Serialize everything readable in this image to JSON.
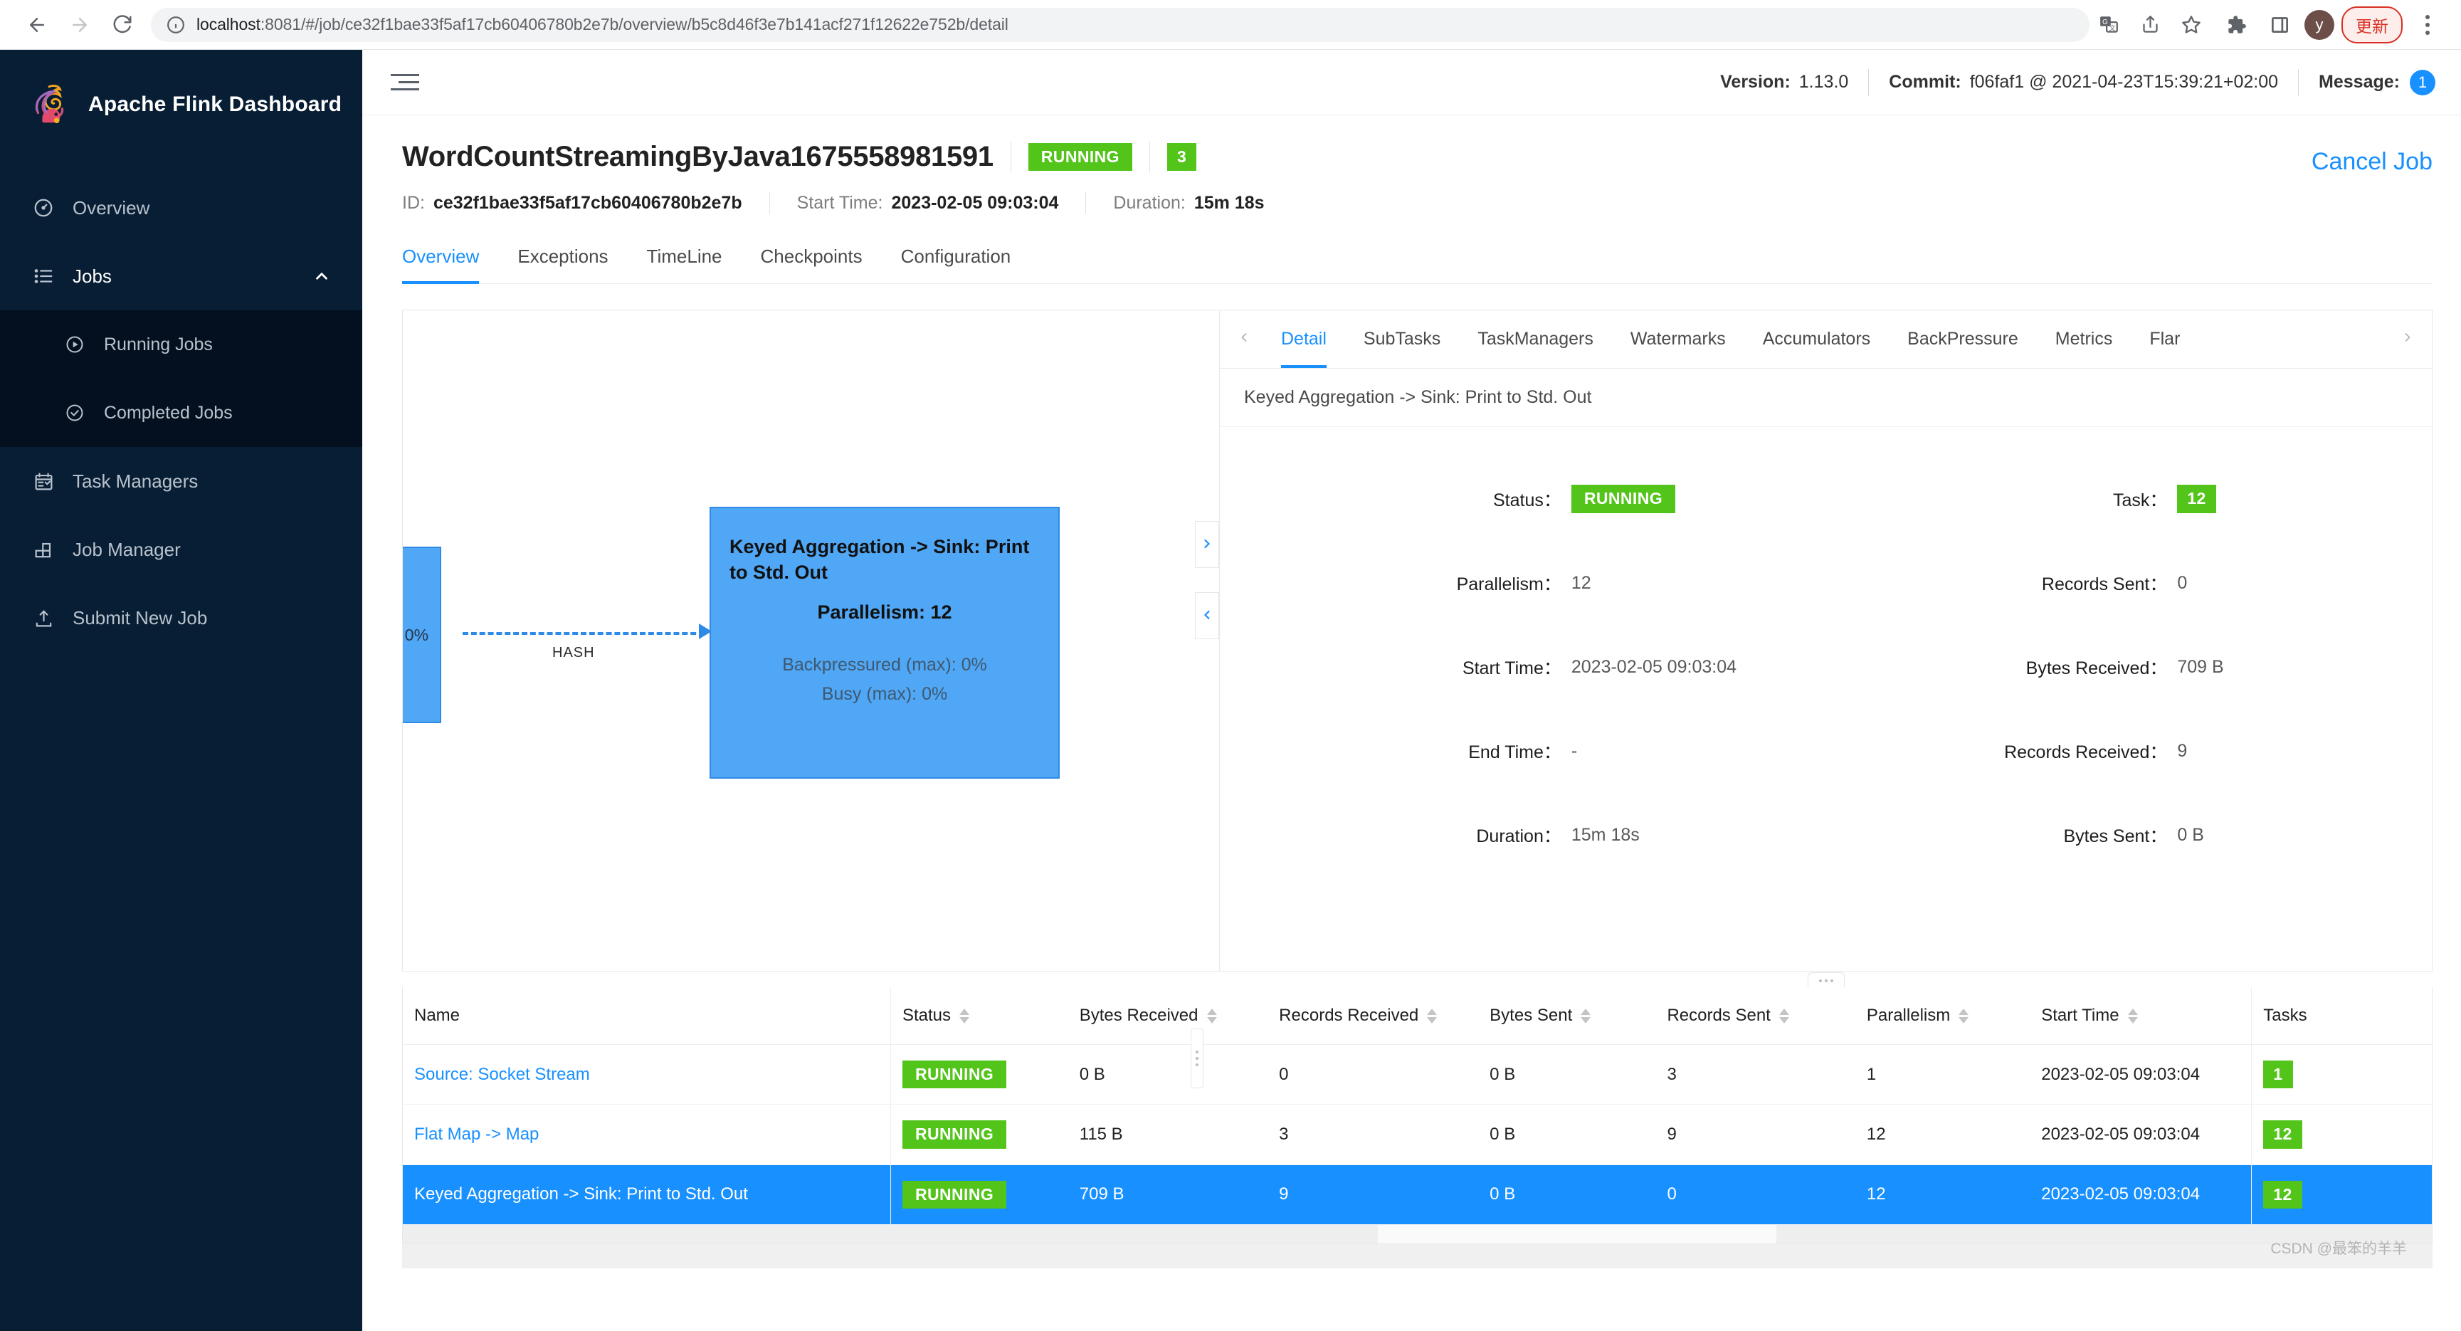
{
  "browser": {
    "url_host": "localhost",
    "url_path": ":8081/#/job/ce32f1bae33f5af17cb60406780b2e7b/overview/b5c8d46f3e7b141acf271f12622e752b/detail",
    "back_icon": "back-arrow-icon",
    "forward_icon": "forward-arrow-icon",
    "reload_icon": "reload-icon",
    "info_icon": "site-info-icon",
    "translate_icon": "translate-icon",
    "share_icon": "share-icon",
    "bookmark_icon": "star-icon",
    "extensions_icon": "puzzle-icon",
    "sidepanel_icon": "side-panel-icon",
    "profile_initial": "y",
    "update_label": "更新",
    "menu_icon": "kebab-menu-icon"
  },
  "sidebar": {
    "brand": "Apache Flink Dashboard",
    "items": [
      {
        "label": "Overview",
        "icon": "gauge-icon"
      },
      {
        "label": "Jobs",
        "icon": "list-icon",
        "chevron": "chevron-up-icon"
      },
      {
        "label": "Running Jobs",
        "icon": "play-circle-icon"
      },
      {
        "label": "Completed Jobs",
        "icon": "check-circle-icon"
      },
      {
        "label": "Task Managers",
        "icon": "calendar-check-icon"
      },
      {
        "label": "Job Manager",
        "icon": "blocks-icon"
      },
      {
        "label": "Submit New Job",
        "icon": "upload-icon"
      }
    ]
  },
  "topbar": {
    "menu_toggle_icon": "hamburger-icon",
    "version_label": "Version:",
    "version_value": "1.13.0",
    "commit_label": "Commit:",
    "commit_value": "f06faf1 @ 2021-04-23T15:39:21+02:00",
    "message_label": "Message:",
    "message_count": "1"
  },
  "job": {
    "name": "WordCountStreamingByJava1675558981591",
    "status": "RUNNING",
    "task_count": "3",
    "id_label": "ID:",
    "id_value": "ce32f1bae33f5af17cb60406780b2e7b",
    "start_time_label": "Start Time:",
    "start_time_value": "2023-02-05 09:03:04",
    "duration_label": "Duration:",
    "duration_value": "15m 18s",
    "cancel_label": "Cancel Job",
    "tabs": [
      {
        "label": "Overview"
      },
      {
        "label": "Exceptions"
      },
      {
        "label": "TimeLine"
      },
      {
        "label": "Checkpoints"
      },
      {
        "label": "Configuration"
      }
    ]
  },
  "graph": {
    "partial_node_pct": ": 0%",
    "edge_label": "HASH",
    "main_node": {
      "name": "Keyed Aggregation -> Sink: Print to Std. Out",
      "parallelism": "Parallelism: 12",
      "backpressured": "Backpressured (max): 0%",
      "busy": "Busy (max): 0%"
    },
    "scroll_right_icon": "chevron-right-icon",
    "scroll_left_icon": "chevron-left-icon"
  },
  "detail": {
    "tabs": [
      {
        "label": "Detail"
      },
      {
        "label": "SubTasks"
      },
      {
        "label": "TaskManagers"
      },
      {
        "label": "Watermarks"
      },
      {
        "label": "Accumulators"
      },
      {
        "label": "BackPressure"
      },
      {
        "label": "Metrics"
      },
      {
        "label": "Flar"
      }
    ],
    "prev_icon": "chevron-left-icon",
    "next_icon": "chevron-right-icon",
    "subtitle": "Keyed Aggregation -> Sink: Print to Std. Out",
    "fields": {
      "status_label": "Status：",
      "status_value": "RUNNING",
      "task_label": "Task：",
      "task_value": "12",
      "parallelism_label": "Parallelism：",
      "parallelism_value": "12",
      "records_sent_label": "Records Sent：",
      "records_sent_value": "0",
      "start_time_label": "Start Time：",
      "start_time_value": "2023-02-05 09:03:04",
      "bytes_received_label": "Bytes Received：",
      "bytes_received_value": "709 B",
      "end_time_label": "End Time：",
      "end_time_value": "-",
      "records_received_label": "Records Received：",
      "records_received_value": "9",
      "duration_label": "Duration：",
      "duration_value": "15m 18s",
      "bytes_sent_label": "Bytes Sent：",
      "bytes_sent_value": "0 B"
    }
  },
  "table": {
    "columns": [
      {
        "label": "Name",
        "sortable": false
      },
      {
        "label": "Status",
        "sortable": true
      },
      {
        "label": "Bytes Received",
        "sortable": true
      },
      {
        "label": "Records Received",
        "sortable": true
      },
      {
        "label": "Bytes Sent",
        "sortable": true
      },
      {
        "label": "Records Sent",
        "sortable": true
      },
      {
        "label": "Parallelism",
        "sortable": true
      },
      {
        "label": "Start Time",
        "sortable": true
      },
      {
        "label": "Tasks",
        "sortable": false
      }
    ],
    "rows": [
      {
        "name": "Source: Socket Stream",
        "status": "RUNNING",
        "bytes_received": "0 B",
        "records_received": "0",
        "bytes_sent": "0 B",
        "records_sent": "3",
        "parallelism": "1",
        "start_time": "2023-02-05 09:03:04",
        "tasks": "1",
        "selected": false
      },
      {
        "name": "Flat Map -> Map",
        "status": "RUNNING",
        "bytes_received": "115 B",
        "records_received": "3",
        "bytes_sent": "0 B",
        "records_sent": "9",
        "parallelism": "12",
        "start_time": "2023-02-05 09:03:04",
        "tasks": "12",
        "selected": false
      },
      {
        "name": "Keyed Aggregation -> Sink: Print to Std. Out",
        "status": "RUNNING",
        "bytes_received": "709 B",
        "records_received": "9",
        "bytes_sent": "0 B",
        "records_sent": "0",
        "parallelism": "12",
        "start_time": "2023-02-05 09:03:04",
        "tasks": "12",
        "selected": true
      }
    ]
  },
  "watermark": "CSDN @最笨的羊羊",
  "colors": {
    "accent": "#1890ff",
    "success": "#52c41a",
    "sidebar_bg": "#081e35",
    "node_fill": "#50a7f5"
  }
}
